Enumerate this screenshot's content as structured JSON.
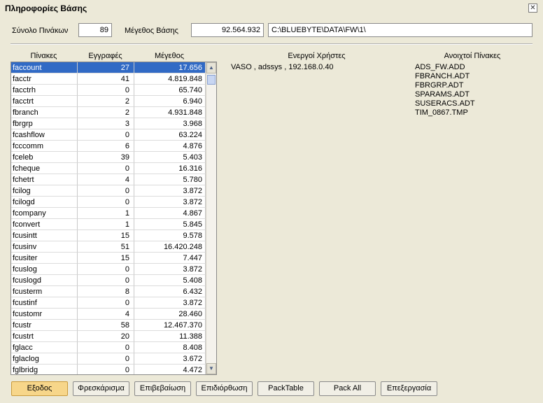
{
  "window": {
    "title": "Πληροφορίες Βάσης"
  },
  "summary": {
    "tables_label": "Σύνολο Πινάκων",
    "tables_value": "89",
    "size_label": "Μέγεθος Βάσης",
    "size_value": "92.564.932",
    "path_value": "C:\\BLUEBYTE\\DATA\\FW\\1\\"
  },
  "table": {
    "headers": [
      "Πίνακες",
      "Εγγραφές",
      "Μέγεθος"
    ],
    "rows": [
      [
        "faccount",
        "27",
        "17.656"
      ],
      [
        "facctr",
        "41",
        "4.819.848"
      ],
      [
        "facctrh",
        "0",
        "65.740"
      ],
      [
        "facctrt",
        "2",
        "6.940"
      ],
      [
        "fbranch",
        "2",
        "4.931.848"
      ],
      [
        "fbrgrp",
        "3",
        "3.968"
      ],
      [
        "fcashflow",
        "0",
        "63.224"
      ],
      [
        "fcccomm",
        "6",
        "4.876"
      ],
      [
        "fceleb",
        "39",
        "5.403"
      ],
      [
        "fcheque",
        "0",
        "16.316"
      ],
      [
        "fchetrt",
        "4",
        "5.780"
      ],
      [
        "fcilog",
        "0",
        "3.872"
      ],
      [
        "fcilogd",
        "0",
        "3.872"
      ],
      [
        "fcompany",
        "1",
        "4.867"
      ],
      [
        "fconvert",
        "1",
        "5.845"
      ],
      [
        "fcusintt",
        "15",
        "9.578"
      ],
      [
        "fcusinv",
        "51",
        "16.420.248"
      ],
      [
        "fcusiter",
        "15",
        "7.447"
      ],
      [
        "fcuslog",
        "0",
        "3.872"
      ],
      [
        "fcuslogd",
        "0",
        "5.408"
      ],
      [
        "fcusterm",
        "8",
        "6.432"
      ],
      [
        "fcustinf",
        "0",
        "3.872"
      ],
      [
        "fcustomr",
        "4",
        "28.460"
      ],
      [
        "fcustr",
        "58",
        "12.467.370"
      ],
      [
        "fcustrt",
        "20",
        "11.388"
      ],
      [
        "fglacc",
        "0",
        "8.408"
      ],
      [
        "fglaclog",
        "0",
        "3.672"
      ],
      [
        "fglbridg",
        "0",
        "4.472"
      ]
    ]
  },
  "active_users": {
    "header": "Ενεργοί Χρήστες",
    "items": [
      "VASO , adssys , 192.168.0.40"
    ]
  },
  "open_tables": {
    "header": "Ανοιχτοί Πίνακες",
    "items": [
      "ADS_FW.ADD",
      "FBRANCH.ADT",
      "FBRGRP.ADT",
      "SPARAMS.ADT",
      "SUSERACS.ADT",
      "TIM_0867.TMP"
    ]
  },
  "buttons": [
    "Εξοδος",
    "Φρεσκάρισμα",
    "Επιβεβαίωση",
    "Επιδιόρθωση",
    "PackTable",
    "Pack All",
    "Επεξεργασία"
  ],
  "icons": {
    "close": "close-icon",
    "scroll_up": "arrow-up-icon",
    "scroll_down": "arrow-down-icon"
  },
  "colors": {
    "selection": "#316AC5",
    "primary_button": "#F7D68A",
    "background": "#ECE9D8"
  }
}
